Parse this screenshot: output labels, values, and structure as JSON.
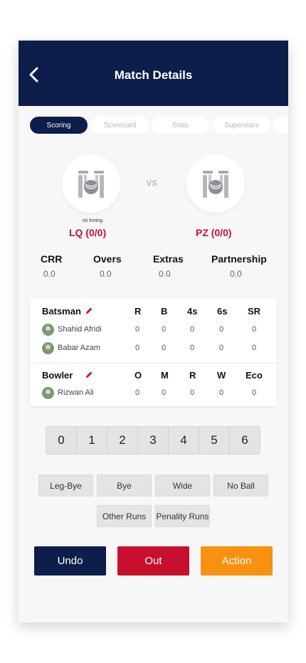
{
  "header": {
    "title": "Match Details"
  },
  "tabs": [
    {
      "label": "Scoring"
    },
    {
      "label": "Scorecard"
    },
    {
      "label": "Stats"
    },
    {
      "label": "Superstars"
    }
  ],
  "match": {
    "vs_label": "VS",
    "inning_label": "Ist Inning",
    "team1_score": "LQ (0/0)",
    "team2_score": "PZ (0/0)"
  },
  "summary": {
    "crr_label": "CRR",
    "crr_value": "0.0",
    "overs_label": "Overs",
    "overs_value": "0.0",
    "extras_label": "Extras",
    "extras_value": "0.0",
    "partnership_label": "Partnership",
    "partnership_value": "0.0"
  },
  "batting": {
    "title": "Batsman",
    "columns": [
      "R",
      "B",
      "4s",
      "6s",
      "SR"
    ],
    "rows": [
      {
        "name": "Shahid Afridi",
        "values": [
          "0",
          "0",
          "0",
          "0",
          "0"
        ]
      },
      {
        "name": "Babar Azam",
        "values": [
          "0",
          "0",
          "0",
          "0",
          "0"
        ]
      }
    ]
  },
  "bowling": {
    "title": "Bowler",
    "columns": [
      "O",
      "M",
      "R",
      "W",
      "Eco"
    ],
    "rows": [
      {
        "name": "Rizwan Ali",
        "values": [
          "0",
          "0",
          "0",
          "0",
          "0"
        ]
      }
    ]
  },
  "runs_pad": [
    "0",
    "1",
    "2",
    "3",
    "4",
    "5",
    "6"
  ],
  "extras_buttons": [
    "Leg-Bye",
    "Bye",
    "Wide",
    "No Ball",
    "Other Runs",
    "Penality Runs"
  ],
  "actions": {
    "undo": "Undo",
    "out": "Out",
    "action": "Action"
  },
  "colors": {
    "navy": "#0d1e4a",
    "red": "#c8102e",
    "orange": "#f7910f",
    "edit_icon": "#c8102e"
  },
  "icons": {
    "back": "chevron-left-icon",
    "team_logo": "cricket-stumps-ball-icon",
    "edit": "pencil-icon"
  }
}
